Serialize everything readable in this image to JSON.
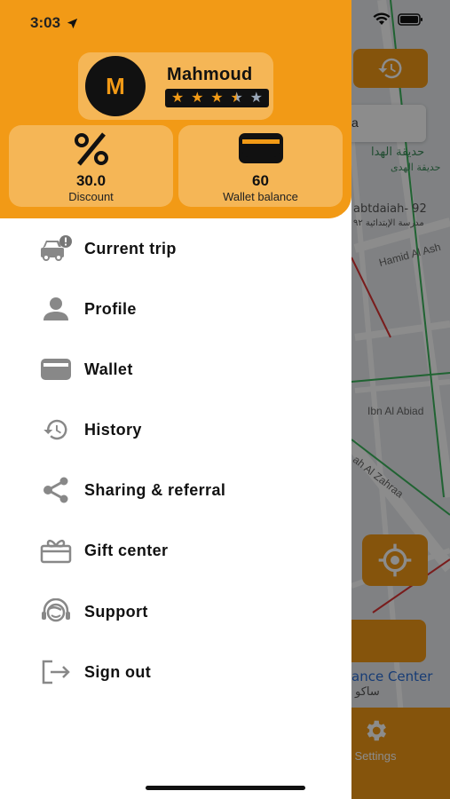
{
  "status_bar": {
    "time": "3:03"
  },
  "user": {
    "avatar_initial": "M",
    "name": "Mahmoud",
    "rating": 3.5,
    "rating_max": 5
  },
  "stats": {
    "discount": {
      "value": "30.0",
      "label": "Discount",
      "icon": "percent-icon"
    },
    "wallet": {
      "value": "60",
      "label": "Wallet balance",
      "icon": "wallet-icon"
    }
  },
  "menu": [
    {
      "label": "Current trip",
      "icon": "car-alert-icon"
    },
    {
      "label": "Profile",
      "icon": "person-icon"
    },
    {
      "label": "Wallet",
      "icon": "wallet-icon"
    },
    {
      "label": "History",
      "icon": "history-icon"
    },
    {
      "label": "Sharing & referral",
      "icon": "share-icon"
    },
    {
      "label": "Gift center",
      "icon": "gift-icon"
    },
    {
      "label": "Support",
      "icon": "support-icon"
    },
    {
      "label": "Sign out",
      "icon": "sign-out-icon"
    }
  ],
  "map": {
    "search_text": "a",
    "poi_1": "حديقة الهدا",
    "poi_2": "حديقة الهدى",
    "poi_3": "abtdaiah- 92",
    "poi_4": "مدرسة الإبتدائية ٩٢",
    "road_1": "Hamid Al Ash",
    "road_2": "Ibn Al Abiad",
    "road_3": "ah Al Zahraa",
    "place_1": "ance Center",
    "place_2": "ساكو",
    "settings_label": "Settings"
  },
  "colors": {
    "accent": "#f29a16",
    "text": "#111111",
    "icon_gray": "#777777"
  }
}
